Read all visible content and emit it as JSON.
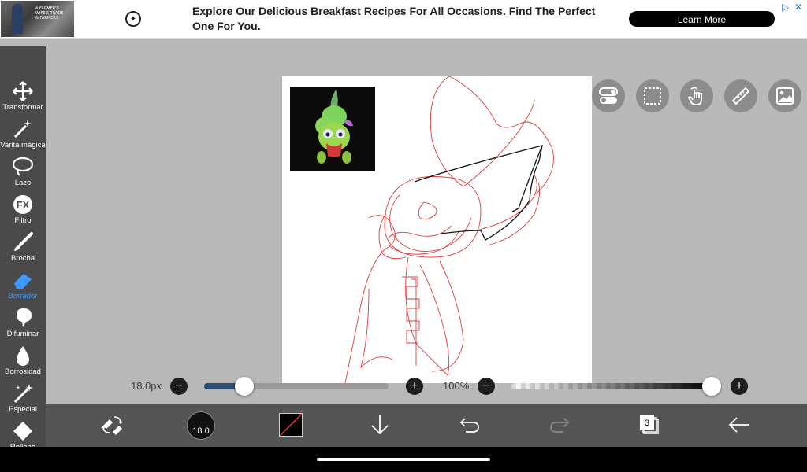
{
  "ad": {
    "thumb_text": "A FARMER'S WIFE'S TRADE & FARMERS",
    "headline": "Explore Our Delicious Breakfast Recipes For All Occasions. Find The Perfect One For You.",
    "cta_label": "Learn More",
    "logo_icon": "brand-logo-icon",
    "choices_icon": "adchoices-icon",
    "close_icon": "close-icon"
  },
  "left_tools": [
    {
      "label": "Transformar",
      "icon": "move-arrows-icon",
      "active": false
    },
    {
      "label": "Varita mágica",
      "icon": "magic-wand-icon",
      "active": false
    },
    {
      "label": "Lazo",
      "icon": "lasso-icon",
      "active": false
    },
    {
      "label": "Filtro",
      "icon": "fx-filter-icon",
      "active": false
    },
    {
      "label": "Brocha",
      "icon": "brush-icon",
      "active": false
    },
    {
      "label": "Borrador",
      "icon": "eraser-icon",
      "active": true
    },
    {
      "label": "Difuminar",
      "icon": "smudge-icon",
      "active": false
    },
    {
      "label": "Borrosidad",
      "icon": "blur-drop-icon",
      "active": false
    },
    {
      "label": "Especial",
      "icon": "special-sparkle-icon",
      "active": false
    },
    {
      "label": "Relleno",
      "icon": "fill-bucket-icon",
      "active": false
    }
  ],
  "right_tools": [
    "toggle-icon",
    "selection-icon",
    "touch-icon",
    "ruler-icon",
    "image-icon"
  ],
  "sliders": {
    "brush_size_label": "18.0px",
    "brush_size_fraction": 0.22,
    "opacity_label": "100%",
    "opacity_fraction": 1.0,
    "minus": "−",
    "plus": "+"
  },
  "bottom_bar": {
    "brush_size_value": "18.0",
    "layers_count": "3",
    "icons": [
      "swap-tool-icon",
      "brush-size-icon",
      "color-icon",
      "download-icon",
      "undo-icon",
      "redo-icon",
      "layers-icon",
      "back-icon"
    ]
  },
  "colors": {
    "accent": "#3d9bff",
    "sketch": "#e23b3b",
    "toolbar": "#4a4a4a",
    "workspace": "#b8b8b8",
    "size_track": "#2e4d73"
  }
}
